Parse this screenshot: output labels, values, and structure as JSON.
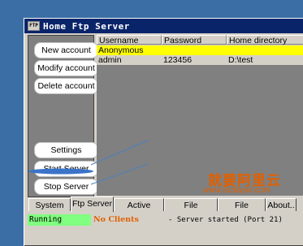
{
  "window": {
    "title": "Home Ftp Server",
    "icon": "ftp-icon",
    "icon_text": "FTP"
  },
  "sidebar": {
    "buttons": [
      {
        "label": "New account"
      },
      {
        "label": "Modify account"
      },
      {
        "label": "Delete account"
      },
      {
        "label": "Settings"
      },
      {
        "label": "Start Server"
      },
      {
        "label": "Stop Server"
      }
    ]
  },
  "accounts_table": {
    "columns": [
      "Username",
      "Password",
      "Home directory"
    ],
    "rows": [
      {
        "username": "Anonymous",
        "password": "",
        "home": "",
        "selected": true
      },
      {
        "username": "admin",
        "password": "123456",
        "home": "D:\\test",
        "selected": false
      }
    ],
    "selected_color": "#ffff00"
  },
  "tabs": [
    {
      "label": "System Log"
    },
    {
      "label": "Ftp Server",
      "active": true
    },
    {
      "label": "Active Clients"
    },
    {
      "label": "File Monitoring"
    },
    {
      "label": "File Transfers"
    },
    {
      "label": "About.."
    }
  ],
  "status": {
    "state": "Running",
    "state_color": "#80ff80",
    "clients": "No Clients",
    "log": "- Server started (Port 21)"
  },
  "watermark": {
    "text_cn": "就要阿里云",
    "url": "www.91aliyun.com"
  }
}
